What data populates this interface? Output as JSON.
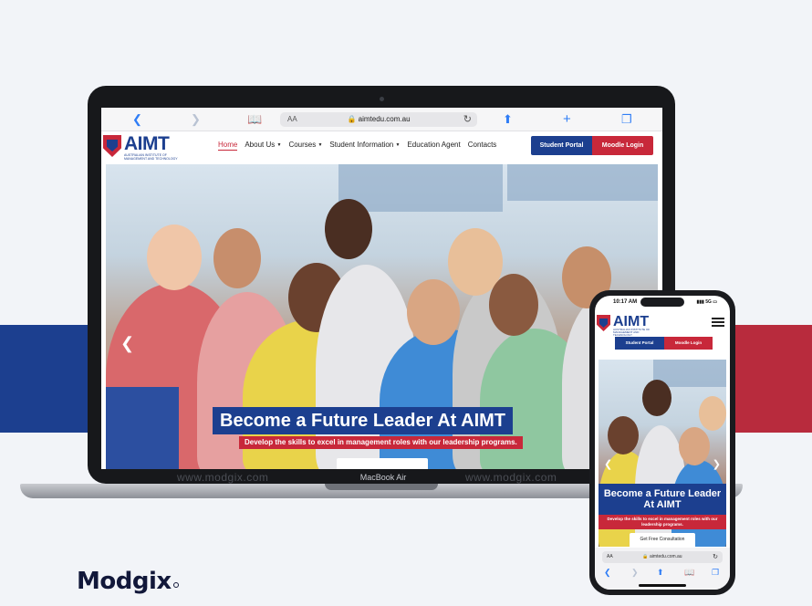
{
  "browser": {
    "back_icon": "chevron-left",
    "forward_icon": "chevron-right",
    "bookmarks_icon": "book-icon",
    "text_size": "AA",
    "url": "aimtedu.com.au",
    "reload_icon": "reload-icon",
    "share_icon": "share-icon",
    "new_tab_icon": "plus-icon",
    "tabs_icon": "tabs-icon"
  },
  "site": {
    "logo_text": "AIMT",
    "logo_subtitle": "AUSTRALIAN INSTITUTE OF MANAGEMENT AND TECHNOLOGY",
    "nav": [
      {
        "label": "Home"
      },
      {
        "label": "About Us"
      },
      {
        "label": "Courses"
      },
      {
        "label": "Student Information"
      },
      {
        "label": "Education Agent"
      },
      {
        "label": "Contacts"
      }
    ],
    "student_portal": "Student Portal",
    "moodle_login": "Moodle Login",
    "hero_title": "Become a Future Leader At AIMT",
    "hero_subtitle": "Develop the skills to excel in management roles with our leadership programs.",
    "hero_prev_icon": "chevron-left-icon"
  },
  "laptop": {
    "label": "MacBook Air",
    "watermark": "www.modgix.com"
  },
  "phone": {
    "time": "10:17 AM",
    "signal": "5G",
    "hero_title": "Become a Future Leader At AIMT",
    "hero_subtitle": "Develop the skills to excel in management roles with our leadership programs.",
    "cta": "Get Free Consultation",
    "url_text_size": "AA",
    "url": "aimtedu.com.au"
  },
  "brand": {
    "name": "Modgix"
  },
  "colors": {
    "blue": "#1c3f8f",
    "red": "#c8283a",
    "ios_blue": "#2f7df6"
  }
}
